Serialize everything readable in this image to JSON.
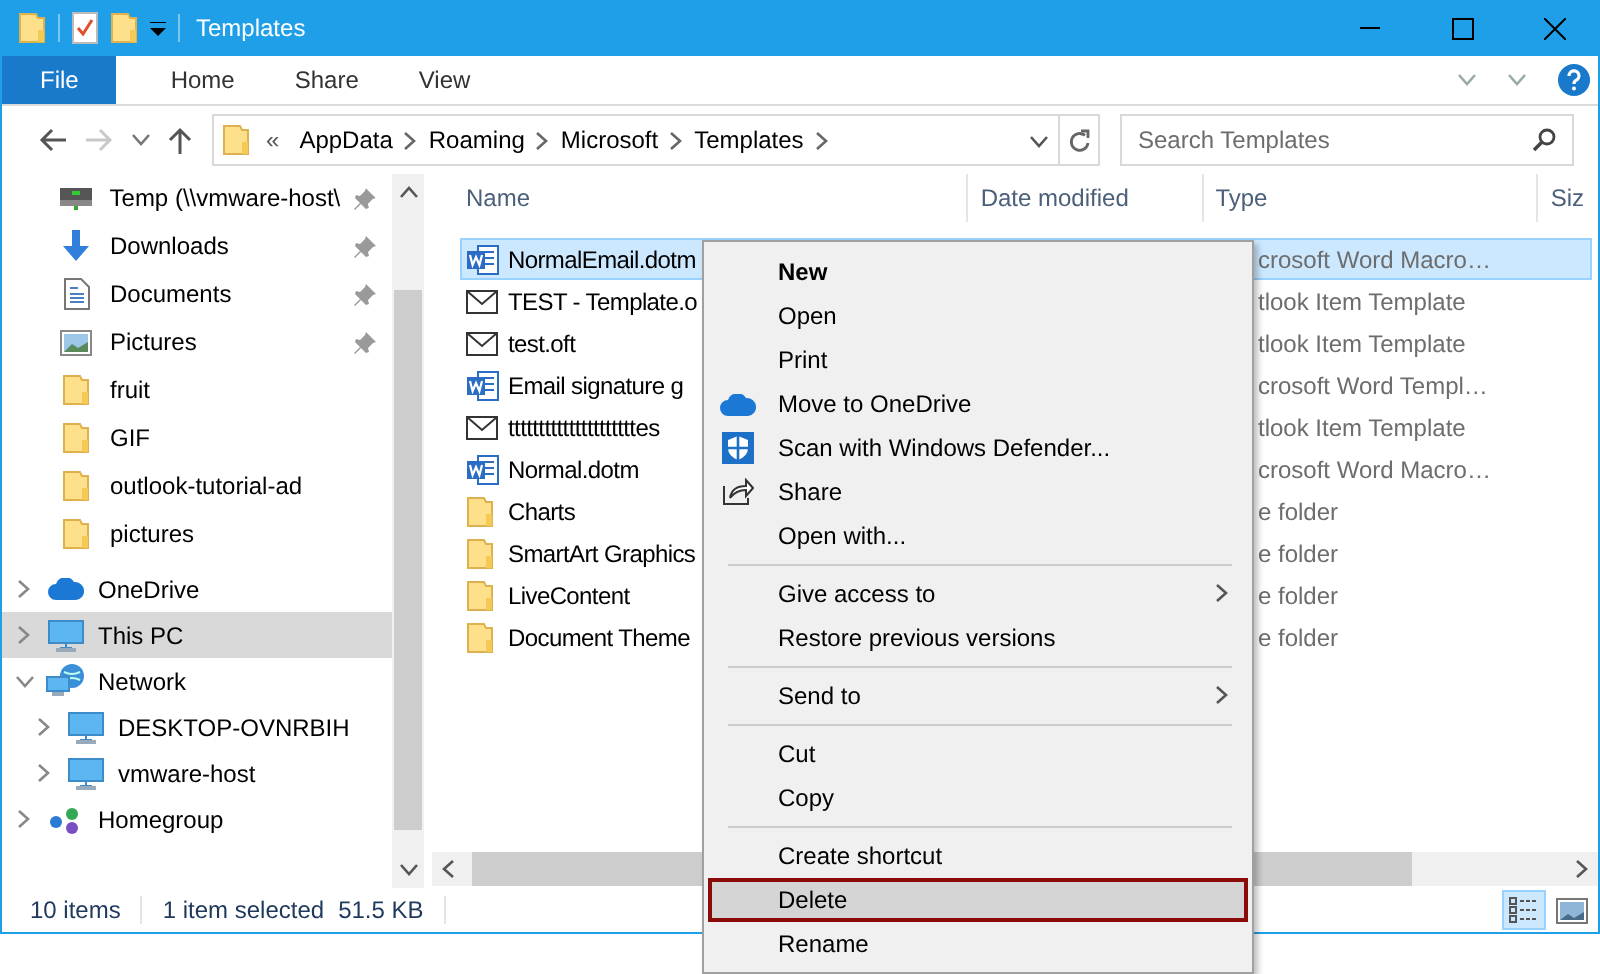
{
  "window": {
    "title": "Templates"
  },
  "ribbon": {
    "tabs": [
      {
        "label": "File",
        "kind": "file",
        "selected": false
      },
      {
        "label": "Home",
        "kind": "tab",
        "selected": false
      },
      {
        "label": "Share",
        "kind": "tab",
        "selected": false
      },
      {
        "label": "View",
        "kind": "tab",
        "selected": false
      }
    ]
  },
  "address_bar": {
    "overflow": "«",
    "crumbs": [
      "AppData",
      "Roaming",
      "Microsoft",
      "Templates"
    ]
  },
  "search": {
    "placeholder": "Search Templates"
  },
  "navigation": {
    "quick_access": [
      {
        "label": "Temp (\\\\vmware-host\\",
        "kind": "drive",
        "pinned": true,
        "selected": false
      },
      {
        "label": "Downloads",
        "kind": "download",
        "pinned": true,
        "selected": false
      },
      {
        "label": "Documents",
        "kind": "documents",
        "pinned": true,
        "selected": false
      },
      {
        "label": "Pictures",
        "kind": "pictures",
        "pinned": true,
        "selected": false
      },
      {
        "label": "fruit",
        "kind": "folder",
        "pinned": false,
        "selected": false
      },
      {
        "label": "GIF",
        "kind": "folder",
        "pinned": false,
        "selected": false
      },
      {
        "label": "outlook-tutorial-ad",
        "kind": "folder",
        "pinned": false,
        "selected": false
      },
      {
        "label": "pictures",
        "kind": "folder",
        "pinned": false,
        "selected": false
      }
    ],
    "tree": [
      {
        "label": "OneDrive",
        "kind": "cloud",
        "expanded": false,
        "selected": false
      },
      {
        "label": "This PC",
        "kind": "pc",
        "expanded": false,
        "selected": true
      },
      {
        "label": "Network",
        "kind": "network",
        "expanded": true,
        "selected": false,
        "children": [
          {
            "label": "DESKTOP-OVNRBIH",
            "kind": "pc",
            "expanded": false,
            "selected": false
          },
          {
            "label": "vmware-host",
            "kind": "pc",
            "expanded": false,
            "selected": false
          }
        ]
      },
      {
        "label": "Homegroup",
        "kind": "homegroup",
        "expanded": false,
        "selected": false
      }
    ]
  },
  "file_list": {
    "columns": [
      "Name",
      "Date modified",
      "Type",
      "Siz"
    ],
    "rows": [
      {
        "name": "NormalEmail.dotm",
        "type": "crosoft Word Macro…",
        "kind": "word",
        "selected": true
      },
      {
        "name": "TEST - Template.o",
        "type": "tlook Item Template",
        "kind": "mail",
        "selected": false
      },
      {
        "name": "test.oft",
        "type": "tlook Item Template",
        "kind": "mail",
        "selected": false
      },
      {
        "name": "Email signature g",
        "type": "crosoft Word Templ…",
        "kind": "word",
        "selected": false
      },
      {
        "name": "tttttttttttttttttttttes",
        "type": "tlook Item Template",
        "kind": "mail",
        "selected": false
      },
      {
        "name": "Normal.dotm",
        "type": "crosoft Word Macro…",
        "kind": "word",
        "selected": false
      },
      {
        "name": "Charts",
        "type": "e folder",
        "kind": "folder",
        "selected": false
      },
      {
        "name": "SmartArt Graphics",
        "type": "e folder",
        "kind": "folder",
        "selected": false
      },
      {
        "name": "LiveContent",
        "type": "e folder",
        "kind": "folder",
        "selected": false
      },
      {
        "name": "Document Theme",
        "type": "e folder",
        "kind": "folder",
        "selected": false
      }
    ]
  },
  "context_menu": {
    "groups": [
      {
        "items": [
          {
            "label": "New",
            "kind": "plain",
            "default": true,
            "highlighted": false,
            "submenu": false
          },
          {
            "label": "Open",
            "kind": "plain",
            "default": false,
            "highlighted": false,
            "submenu": false
          },
          {
            "label": "Print",
            "kind": "plain",
            "default": false,
            "highlighted": false,
            "submenu": false
          },
          {
            "label": "Move to OneDrive",
            "kind": "cloud",
            "default": false,
            "highlighted": false,
            "submenu": false
          },
          {
            "label": "Scan with Windows Defender...",
            "kind": "shield",
            "default": false,
            "highlighted": false,
            "submenu": false
          },
          {
            "label": "Share",
            "kind": "share",
            "default": false,
            "highlighted": false,
            "submenu": false
          },
          {
            "label": "Open with...",
            "kind": "plain",
            "default": false,
            "highlighted": false,
            "submenu": false
          }
        ]
      },
      {
        "items": [
          {
            "label": "Give access to",
            "kind": "plain",
            "default": false,
            "highlighted": false,
            "submenu": true
          },
          {
            "label": "Restore previous versions",
            "kind": "plain",
            "default": false,
            "highlighted": false,
            "submenu": false
          }
        ]
      },
      {
        "items": [
          {
            "label": "Send to",
            "kind": "plain",
            "default": false,
            "highlighted": false,
            "submenu": true
          }
        ]
      },
      {
        "items": [
          {
            "label": "Cut",
            "kind": "plain",
            "default": false,
            "highlighted": false,
            "submenu": false
          },
          {
            "label": "Copy",
            "kind": "plain",
            "default": false,
            "highlighted": false,
            "submenu": false
          }
        ]
      },
      {
        "items": [
          {
            "label": "Create shortcut",
            "kind": "plain",
            "default": false,
            "highlighted": false,
            "submenu": false
          },
          {
            "label": "Delete",
            "kind": "plain",
            "default": false,
            "highlighted": true,
            "submenu": false
          },
          {
            "label": "Rename",
            "kind": "plain",
            "default": false,
            "highlighted": false,
            "submenu": false
          }
        ]
      }
    ]
  },
  "status_bar": {
    "item_count": "10 items",
    "selection": "1 item selected",
    "size": "51.5 KB",
    "views": [
      {
        "kind": "details",
        "selected": true
      },
      {
        "kind": "large_icons",
        "selected": false
      }
    ]
  }
}
